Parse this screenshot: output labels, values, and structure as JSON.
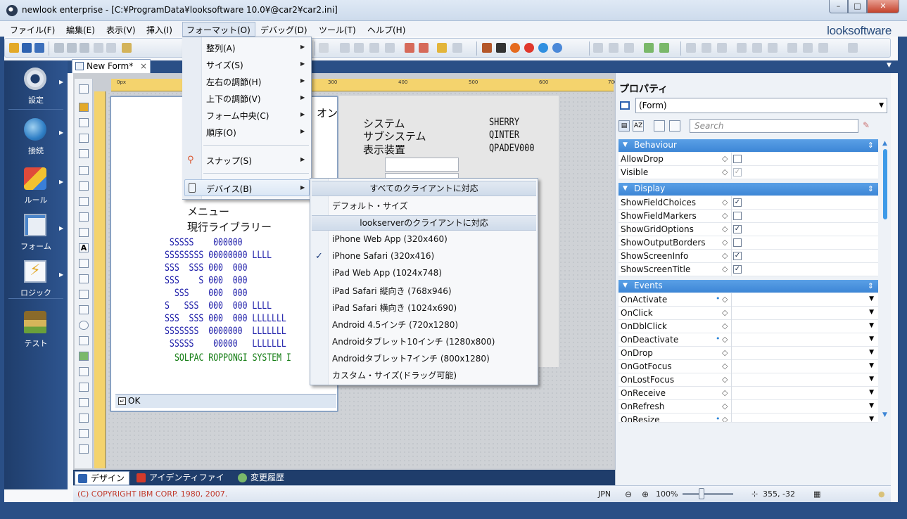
{
  "window": {
    "title": "newlook enterprise - [C:¥ProgramData¥looksoftware 10.0¥@car2¥car2.ini]",
    "brand": "looksoftware",
    "controls": {
      "minimize": "–",
      "maximize": "□",
      "close": "✕"
    }
  },
  "menubar": {
    "items": [
      "ファイル(F)",
      "編集(E)",
      "表示(V)",
      "挿入(I)",
      "フォーマット(O)",
      "デバッグ(D)",
      "ツール(T)",
      "ヘルプ(H)"
    ]
  },
  "format_menu": {
    "items": [
      "整列(A)",
      "サイズ(S)",
      "左右の調節(H)",
      "上下の調節(V)",
      "フォーム中央(C)",
      "順序(O)",
      "スナップ(S)",
      "デバイス(B)"
    ],
    "highlighted": "デバイス(B)"
  },
  "device_menu": {
    "header_all": "すべてのクライアントに対応",
    "default_size": "デフォルト・サイズ",
    "header_lookserver": "lookserverのクライアントに対応",
    "items": [
      "iPhone Web App (320x460)",
      "iPhone Safari (320x416)",
      "iPad Web App (1024x748)",
      "iPad Safari 縦向き (768x946)",
      "iPad Safari 横向き (1024x690)",
      "Android 4.5インチ (720x1280)",
      "Androidタブレット10インチ (1280x800)",
      "Androidタブレット7インチ (800x1280)",
      "カスタム・サイズ(ドラッグ可能)"
    ],
    "checked": "iPhone Safari (320x416)"
  },
  "leftnav": {
    "items": [
      {
        "label": "設定",
        "icon": "gear-icon"
      },
      {
        "label": "接続",
        "icon": "globe-connect-icon"
      },
      {
        "label": "ルール",
        "icon": "shapes-icon"
      },
      {
        "label": "フォーム",
        "icon": "form-icon"
      },
      {
        "label": "ロジック",
        "icon": "logic-bolt-icon"
      },
      {
        "label": "テスト",
        "icon": "stamp-icon"
      }
    ]
  },
  "tabs": {
    "doc_tab": "New Form*",
    "close": "×"
  },
  "ruler": {
    "labels": [
      "0px",
      "300",
      "400",
      "500",
      "600",
      "700"
    ]
  },
  "form": {
    "on_text": "オン",
    "system_labels": [
      "システム",
      "サブシステム",
      "表示装置"
    ],
    "system_values": [
      "SHERRY",
      "QINTER",
      "QPADEV000"
    ],
    "menu_labels": [
      "メニュー",
      "現行ライブラリー"
    ],
    "ascii_blue": [
      " SSSSS    000000",
      "SSSSSSSS 00000000 LLLL",
      "SSS  SSS 000  000",
      "SSS    S 000  000",
      "  SSS    000  000",
      "S   SSS  000  000 LLLL",
      "SSS  SSS 000  000 LLLLLLL",
      "SSSSSSS  0000000  LLLLLLL",
      " SSSSS    00000   LLLLLLL"
    ],
    "ascii_green": "SOLPAC ROPPONGI SYSTEM I",
    "ok_label": "OK"
  },
  "bottom_tabs": [
    "デザイン",
    "アイデンティファイ",
    "変更履歴"
  ],
  "statusbar": {
    "copyright": "(C) COPYRIGHT IBM CORP. 1980, 2007.",
    "lang": "JPN",
    "zoom": "100%",
    "coords": "355, -32",
    "zoom_level": 0.5
  },
  "properties": {
    "title": "プロパティ",
    "selected": "(Form)",
    "search_placeholder": "Search",
    "categories": [
      {
        "name": "Behaviour",
        "rows": [
          {
            "name": "AllowDrop",
            "checked": false,
            "disabled": false
          },
          {
            "name": "Visible",
            "checked": true,
            "disabled": true
          }
        ]
      },
      {
        "name": "Display",
        "rows": [
          {
            "name": "ShowFieldChoices",
            "checked": true
          },
          {
            "name": "ShowFieldMarkers",
            "checked": false
          },
          {
            "name": "ShowGridOptions",
            "checked": true
          },
          {
            "name": "ShowOutputBorders",
            "checked": false
          },
          {
            "name": "ShowScreenInfo",
            "checked": true
          },
          {
            "name": "ShowScreenTitle",
            "checked": true
          }
        ]
      },
      {
        "name": "Events",
        "rows": [
          {
            "name": "OnActivate",
            "dot": true
          },
          {
            "name": "OnClick",
            "dot": false
          },
          {
            "name": "OnDblClick",
            "dot": false
          },
          {
            "name": "OnDeactivate",
            "dot": true
          },
          {
            "name": "OnDrop",
            "dot": false
          },
          {
            "name": "OnGotFocus",
            "dot": false
          },
          {
            "name": "OnLostFocus",
            "dot": false
          },
          {
            "name": "OnReceive",
            "dot": false
          },
          {
            "name": "OnRefresh",
            "dot": false
          },
          {
            "name": "OnResize",
            "dot": true
          }
        ]
      }
    ]
  },
  "colors": {
    "nav_bg": "#1f3d6b",
    "category_header": "#3d86d6",
    "copyright": "#c0392b",
    "ascii_blue": "#1a1aa8",
    "ascii_green": "#0f7a0f"
  }
}
